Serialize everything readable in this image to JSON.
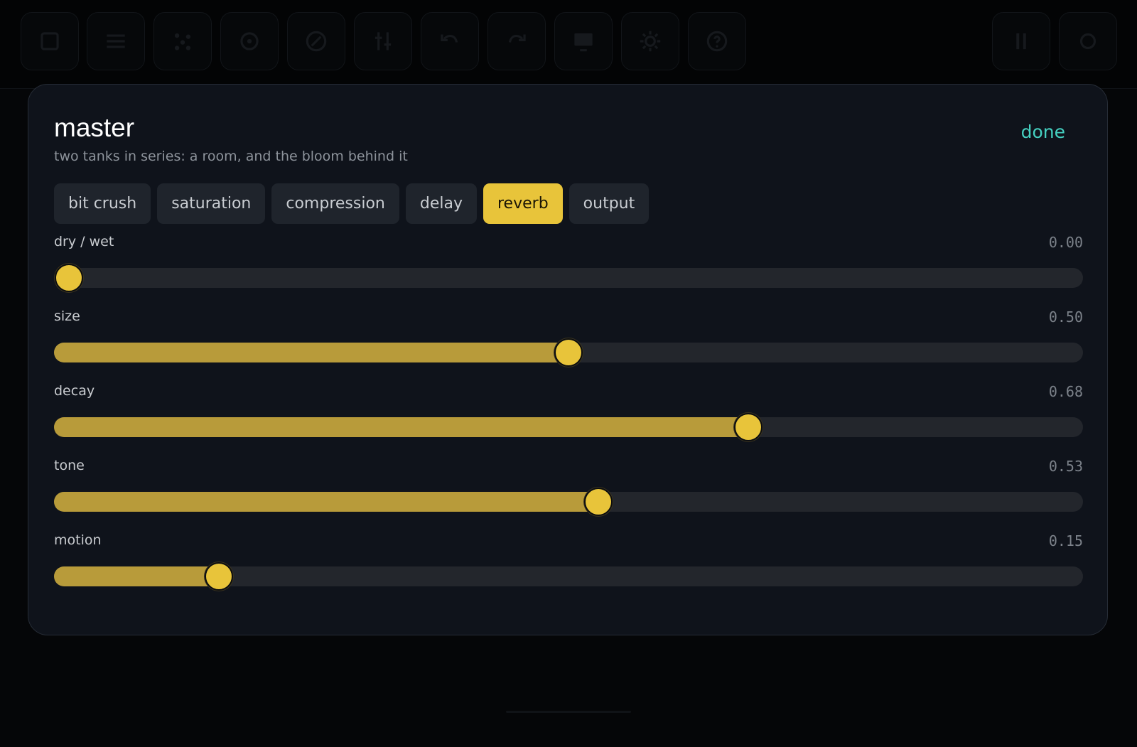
{
  "colors": {
    "accent": "#e8c43a",
    "accent_fill": "#b89b3a",
    "done": "#45d1c1",
    "panel": "#0f131b",
    "track": "#23262c"
  },
  "toolbar": {
    "left_icons": [
      "stop-icon",
      "list-icon",
      "sparkle-icon",
      "cycle-icon",
      "compass-icon",
      "mixer-icon",
      "undo-icon",
      "redo-icon",
      "screen-icon",
      "gear-icon",
      "help-icon"
    ],
    "right_icons": [
      "pause-icon",
      "record-icon"
    ]
  },
  "modal": {
    "title": "master",
    "subtitle": "two tanks in series: a room, and the bloom behind it",
    "done_label": "done",
    "tabs": [
      {
        "label": "bit crush",
        "active": false
      },
      {
        "label": "saturation",
        "active": false
      },
      {
        "label": "compression",
        "active": false
      },
      {
        "label": "delay",
        "active": false
      },
      {
        "label": "reverb",
        "active": true
      },
      {
        "label": "output",
        "active": false
      }
    ],
    "sliders": [
      {
        "label": "dry / wet",
        "display": "0.00",
        "value": 0.0
      },
      {
        "label": "size",
        "display": "0.50",
        "value": 0.5
      },
      {
        "label": "decay",
        "display": "0.68",
        "value": 0.68
      },
      {
        "label": "tone",
        "display": "0.53",
        "value": 0.53
      },
      {
        "label": "motion",
        "display": "0.15",
        "value": 0.15
      }
    ]
  }
}
